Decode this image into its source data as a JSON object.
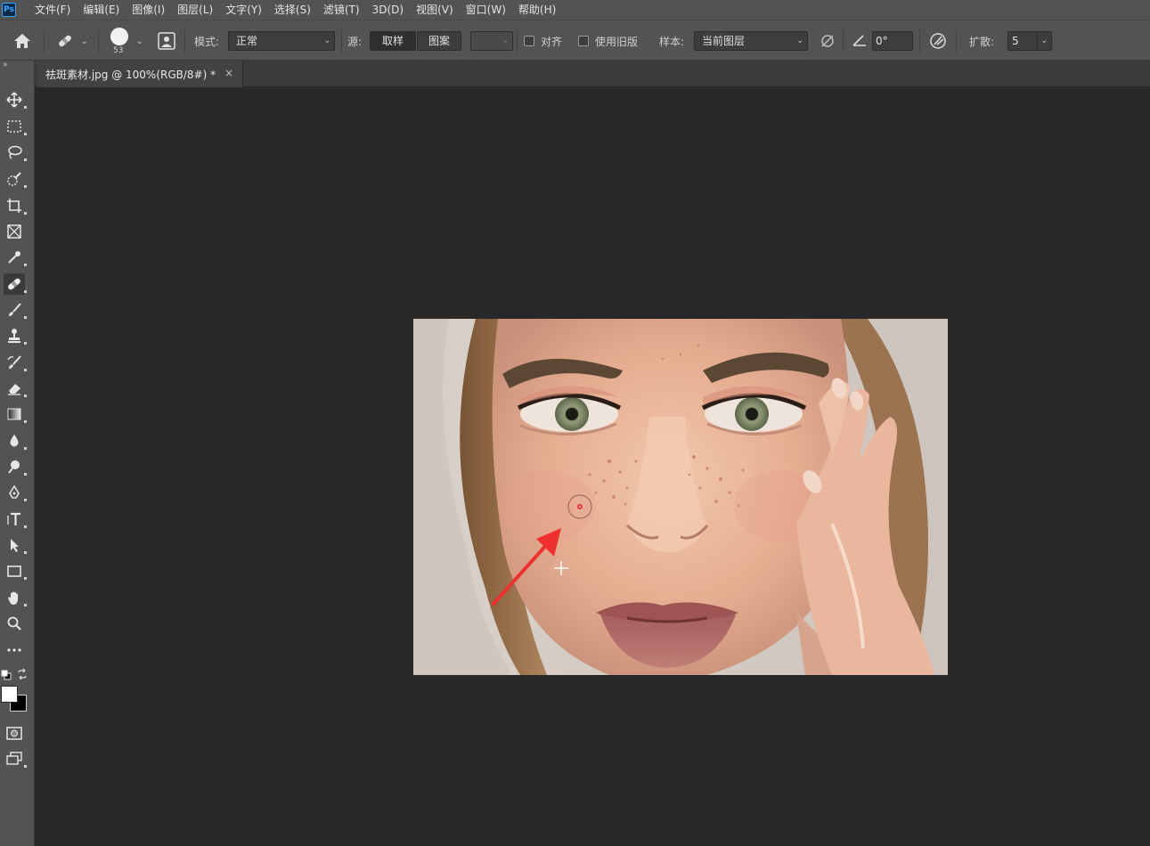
{
  "app": {
    "logo": "Ps"
  },
  "menu": [
    "文件(F)",
    "编辑(E)",
    "图像(I)",
    "图层(L)",
    "文字(Y)",
    "选择(S)",
    "滤镜(T)",
    "3D(D)",
    "视图(V)",
    "窗口(W)",
    "帮助(H)"
  ],
  "options": {
    "brush_size": "53",
    "mode_label": "模式:",
    "mode_value": "正常",
    "source_label": "源:",
    "source_sampled": "取样",
    "source_pattern": "图案",
    "align_label": "对齐",
    "legacy_label": "使用旧版",
    "sample_label": "样本:",
    "sample_value": "当前图层",
    "angle_value": "0°",
    "diffusion_label": "扩散:",
    "diffusion_value": "5"
  },
  "document": {
    "tab_title": "祛斑素材.jpg @ 100%(RGB/8#) *",
    "close_glyph": "×"
  },
  "colors": {
    "annotation_arrow": "#f0302e",
    "foreground": "#ffffff",
    "background": "#000000"
  }
}
